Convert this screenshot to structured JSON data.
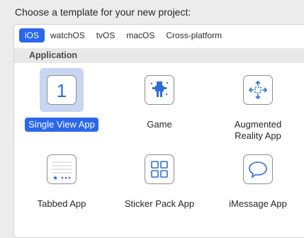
{
  "prompt": "Choose a template for your new project:",
  "tabs": [
    {
      "label": "iOS",
      "active": true
    },
    {
      "label": "watchOS",
      "active": false
    },
    {
      "label": "tvOS",
      "active": false
    },
    {
      "label": "macOS",
      "active": false
    },
    {
      "label": "Cross-platform",
      "active": false
    }
  ],
  "section": {
    "title": "Application"
  },
  "templates": [
    {
      "label": "Single View App",
      "icon": "single-view-icon",
      "selected": true
    },
    {
      "label": "Game",
      "icon": "game-icon",
      "selected": false
    },
    {
      "label": "Augmented\nReality App",
      "icon": "augmented-reality-icon",
      "selected": false
    },
    {
      "label": "Tabbed App",
      "icon": "tabbed-app-icon",
      "selected": false
    },
    {
      "label": "Sticker Pack App",
      "icon": "sticker-pack-icon",
      "selected": false
    },
    {
      "label": "iMessage App",
      "icon": "imessage-icon",
      "selected": false
    }
  ],
  "colors": {
    "accent": "#2b67ea",
    "icon_blue": "#2b6fd6"
  }
}
